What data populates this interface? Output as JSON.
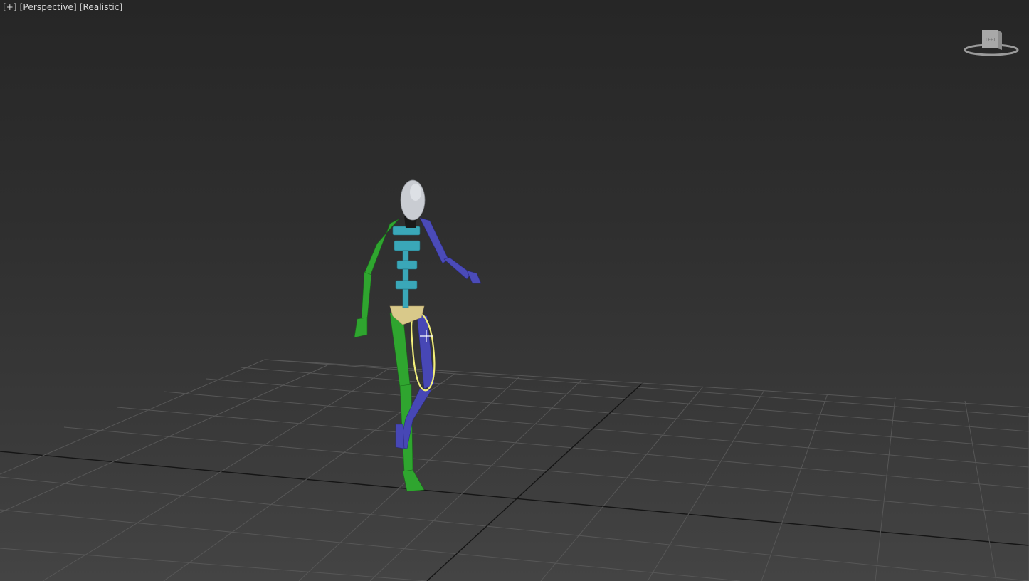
{
  "viewport": {
    "menu_label": "[+]",
    "view_label": "[Perspective]",
    "shading_label": "[Realistic]"
  },
  "viewcube": {
    "face_label": "LEFT"
  },
  "colors": {
    "left_limbs": "#2fa52f",
    "right_limbs": "#4a4ab8",
    "spine": "#3aa7b8",
    "pelvis": "#d9c98a",
    "head": "#c9ccd2",
    "selection": "#f2ef7a",
    "grid": "#555555",
    "grid_axis": "#111111"
  }
}
